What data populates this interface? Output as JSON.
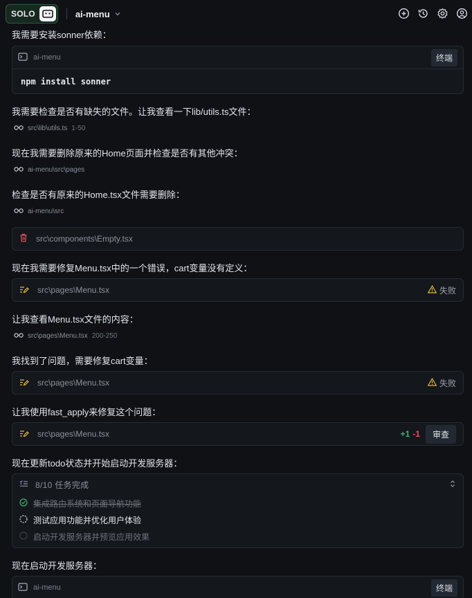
{
  "topbar": {
    "solo": "SOLO",
    "project": "ai-menu"
  },
  "messages": {
    "m1": "我需要安装sonner依赖：",
    "m2": "我需要检查是否有缺失的文件。让我查看一下lib/utils.ts文件：",
    "m3": "现在我需要删除原来的Home页面并检查是否有其他冲突：",
    "m4": "检查是否有原来的Home.tsx文件需要删除：",
    "m5": "现在我需要修复Menu.tsx中的一个错误，cart变量没有定义：",
    "m6": "让我查看Menu.tsx文件的内容：",
    "m7": "我找到了问题，需要修复cart变量：",
    "m8": "让我使用fast_apply来修复这个问题：",
    "m9": "现在更新todo状态并开始启动开发服务器：",
    "m10": "现在启动开发服务器："
  },
  "terminal1": {
    "name": "ai-menu",
    "button": "终端",
    "command": "npm install sonner"
  },
  "reads": {
    "r1": {
      "path": "src\\lib\\utils.ts",
      "lines": "1-50"
    },
    "r2": {
      "path": "ai-menu\\src\\pages"
    },
    "r3": {
      "path": "ai-menu\\src"
    },
    "r4": {
      "path": "src\\pages\\Menu.tsx",
      "lines": "200-250"
    }
  },
  "delete_card": {
    "path": "src\\components\\Empty.tsx"
  },
  "edit1": {
    "path": "src\\pages\\Menu.tsx",
    "status": "失败"
  },
  "edit2": {
    "path": "src\\pages\\Menu.tsx",
    "status": "失败"
  },
  "edit3": {
    "path": "src\\pages\\Menu.tsx",
    "added": "+1",
    "removed": "-1",
    "button": "审查"
  },
  "todo": {
    "count": "8/10 任务完成",
    "items": [
      {
        "text": "集成路由系统和页面导航功能",
        "state": "done"
      },
      {
        "text": "测试应用功能并优化用户体验",
        "state": "in-progress"
      },
      {
        "text": "启动开发服务器并预览应用效果",
        "state": "pending"
      }
    ]
  },
  "terminal2": {
    "name": "ai-menu",
    "button": "终端"
  },
  "colors": {
    "accent_green": "#3fb273",
    "warning": "#e2b93b",
    "delete_red": "#e0575a",
    "background": "#0f1115"
  }
}
